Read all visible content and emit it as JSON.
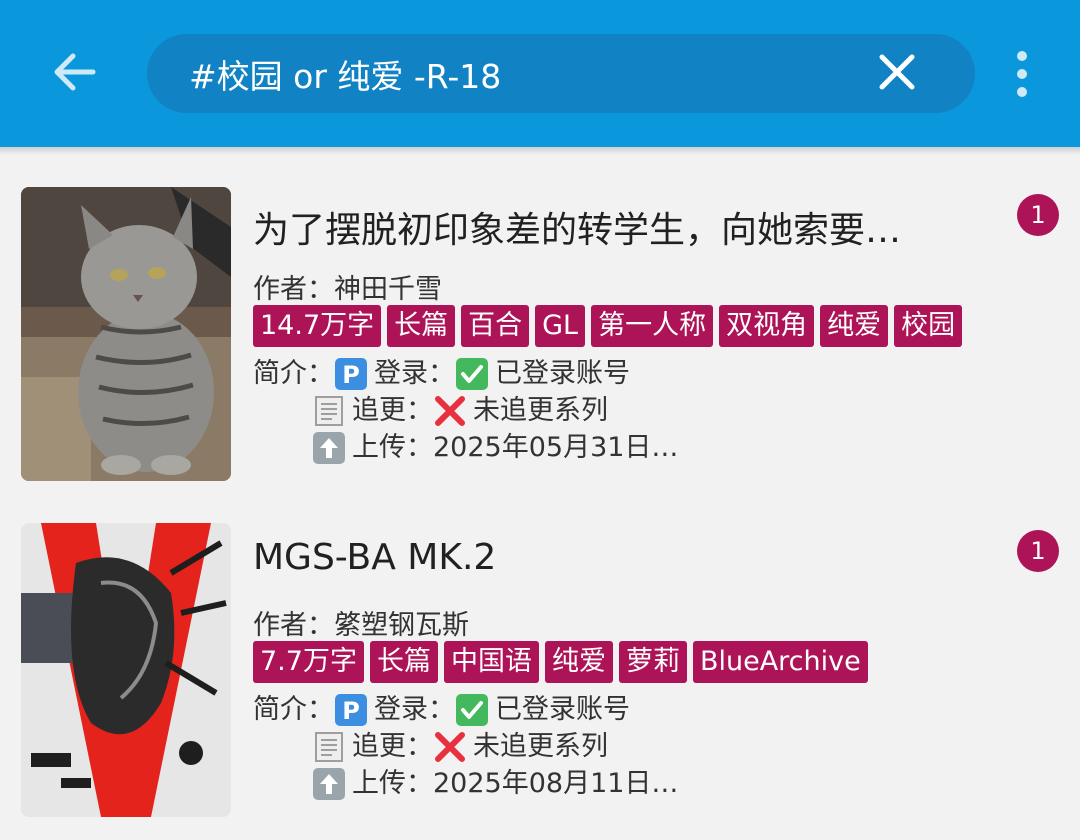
{
  "search": {
    "query": "#校园 or 纯爱 -R-18"
  },
  "books": [
    {
      "title": "为了摆脱初印象差的转学生，向她索要…",
      "author_label": "作者：",
      "author": "神田千雪",
      "tags": [
        "14.7万字",
        "长篇",
        "百合",
        "GL",
        "第一人称",
        "双视角",
        "纯爱",
        "校园"
      ],
      "intro_label": "简介：",
      "login_label": "登录：",
      "login_value": "已登录账号",
      "follow_label": "追更：",
      "follow_value": "未追更系列",
      "upload_label": "上传：",
      "upload_value": "2025年05月31日…",
      "badge": "1"
    },
    {
      "title": "MGS-BA MK.2",
      "author_label": "作者：",
      "author": "綮塑钢瓦斯",
      "tags": [
        "7.7万字",
        "长篇",
        "中国语",
        "纯爱",
        "萝莉",
        "BlueArchive"
      ],
      "intro_label": "简介：",
      "login_label": "登录：",
      "login_value": "已登录账号",
      "follow_label": "追更：",
      "follow_value": "未追更系列",
      "upload_label": "上传：",
      "upload_value": "2025年08月11日…",
      "badge": "1"
    }
  ],
  "icons": {
    "back": "arrow-left-icon",
    "clear": "close-icon",
    "more": "more-vert-icon",
    "parking": "parking-sign-emoji",
    "check": "check-mark-button-emoji",
    "scroll": "page-curl-emoji",
    "cross": "cross-mark-emoji",
    "up": "up-arrow-emoji"
  },
  "colors": {
    "appbar": "#0b97dc",
    "search_bg": "#1183c4",
    "tag": "#ad1457",
    "badge": "#ad1457"
  }
}
